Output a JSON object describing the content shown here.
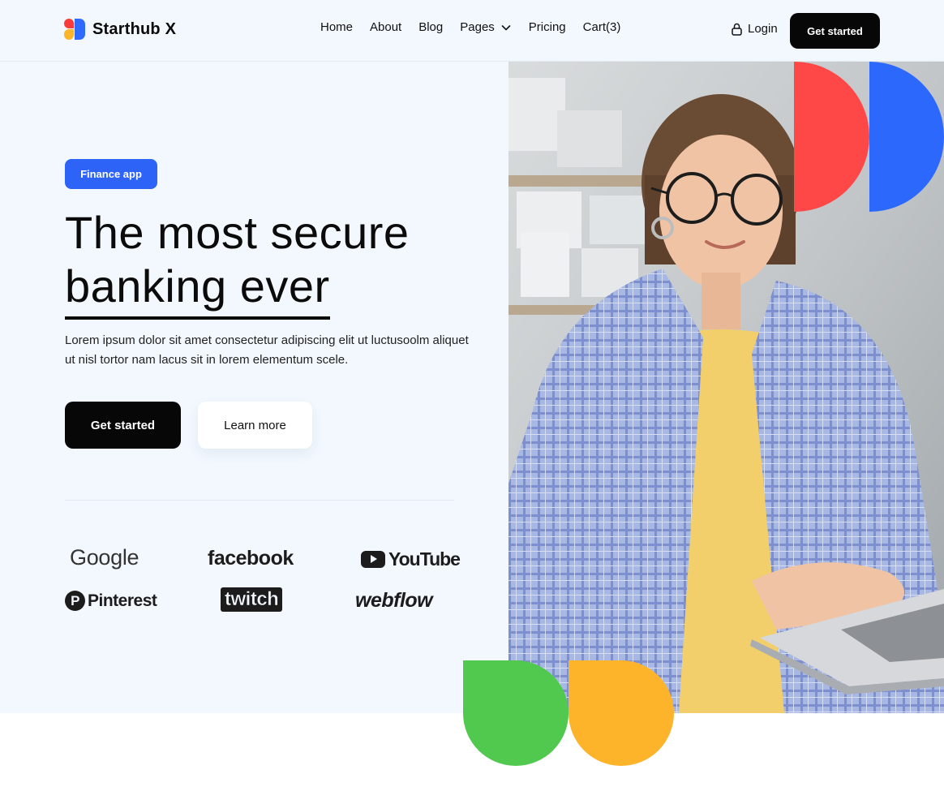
{
  "header": {
    "brand": "Starthub X",
    "nav": [
      "Home",
      "About",
      "Blog",
      "Pages",
      "Pricing",
      "Cart(3)"
    ],
    "login": "Login",
    "cta": "Get started"
  },
  "hero": {
    "badge": "Finance app",
    "title_line1": "The most secure",
    "title_line2": "banking ever",
    "description": "Lorem ipsum dolor sit amet consectetur adipiscing elit ut luctusoolm aliquet ut nisl tortor nam lacus sit in lorem elementum scele.",
    "cta_primary": "Get started",
    "cta_secondary": "Learn more"
  },
  "logos": {
    "google": "Google",
    "facebook": "facebook",
    "youtube": "YouTube",
    "pinterest": "Pinterest",
    "twitch": "twitch",
    "webflow": "webflow"
  },
  "icons": {
    "lock": "lock-icon",
    "chevron": "chevron-down-icon"
  },
  "colors": {
    "hero_bg": "#f2f8fe",
    "badge": "#2e63f7",
    "red": "#fe4848",
    "blue": "#2b68fb",
    "green": "#51c94f",
    "yellow": "#feb42a",
    "dark": "#070707"
  }
}
